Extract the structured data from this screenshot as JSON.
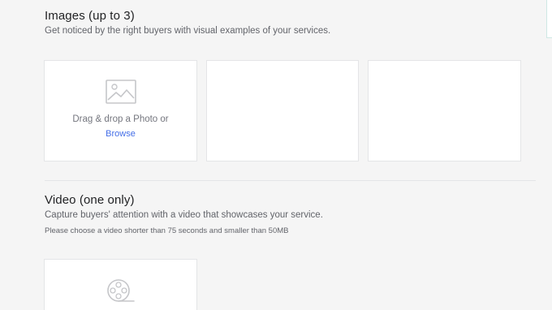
{
  "images_section": {
    "title": "Images (up to 3)",
    "subtitle": "Get noticed by the right buyers with visual examples of your services.",
    "drop_text": "Drag & drop a Photo or",
    "browse_label": "Browse",
    "image_icon": "image-icon"
  },
  "video_section": {
    "title": "Video (one only)",
    "subtitle": "Capture buyers' attention with a video that showcases your service.",
    "note": "Please choose a video shorter than 75 seconds and smaller than 50MB",
    "video_icon": "film-reel-icon"
  },
  "colors": {
    "background": "#f5f5f5",
    "box_background": "#ffffff",
    "border": "#e4e5e7",
    "link": "#446ee7",
    "title": "#222325",
    "muted_text": "#62646a"
  }
}
